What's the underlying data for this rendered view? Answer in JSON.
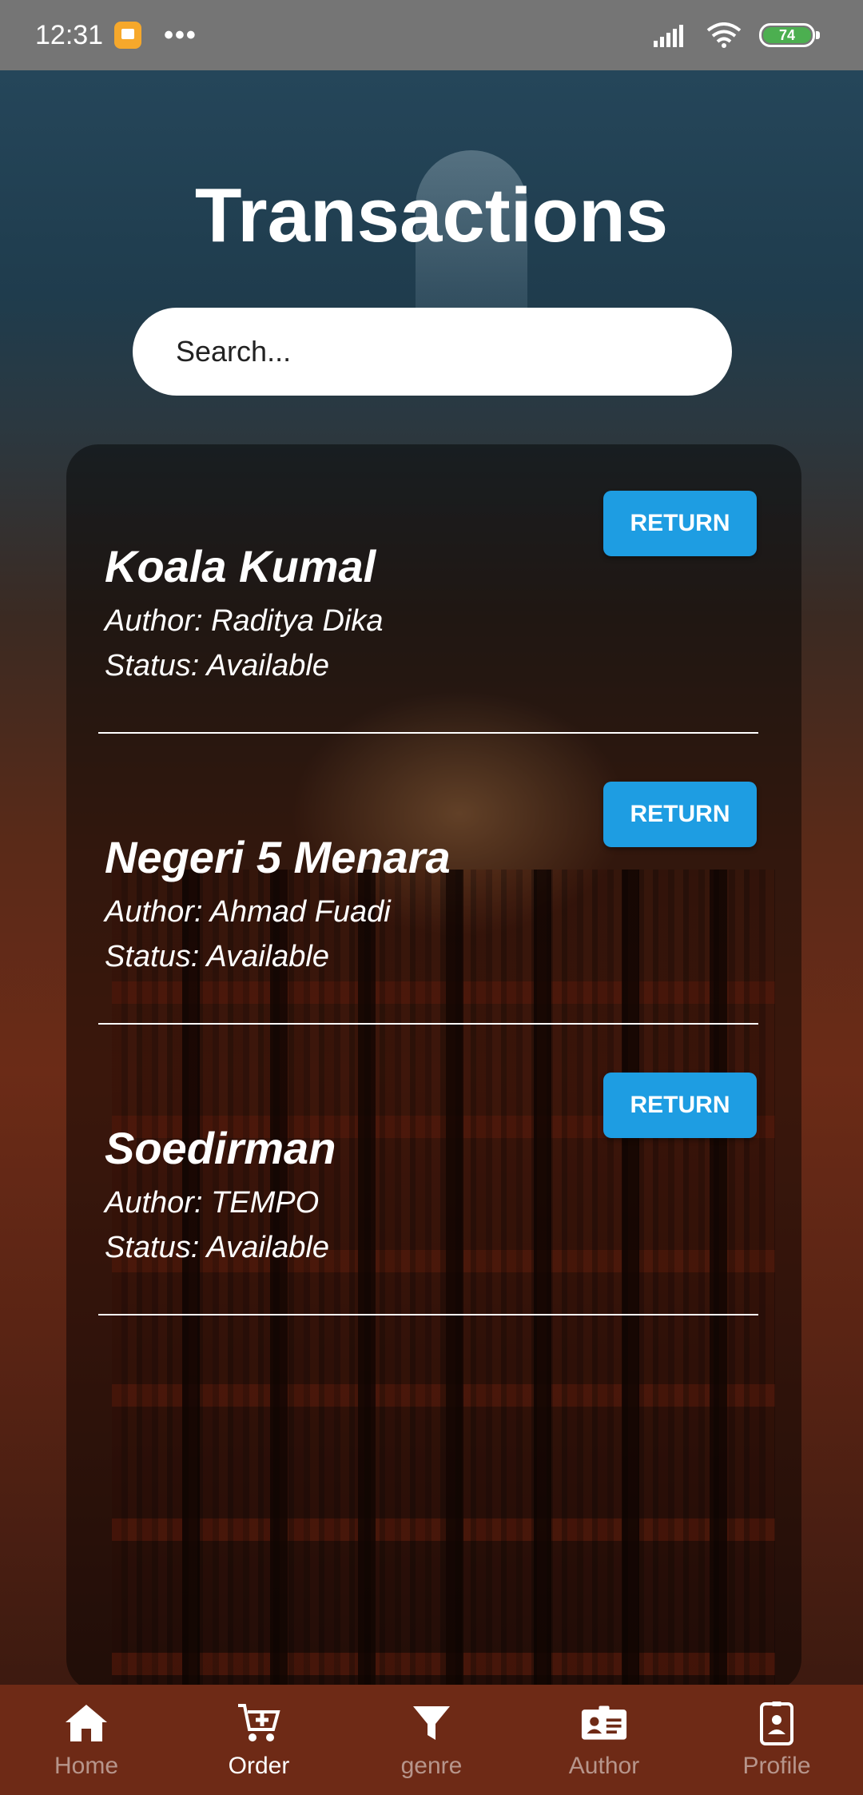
{
  "status_bar": {
    "time": "12:31",
    "more": "•••",
    "battery_level": "74"
  },
  "header": {
    "title": "Transactions"
  },
  "search": {
    "placeholder": "Search..."
  },
  "transactions": [
    {
      "title": "Koala Kumal",
      "author": "Author: Raditya Dika",
      "status": "Status: Available",
      "action": "RETURN"
    },
    {
      "title": "Negeri 5 Menara",
      "author": "Author: Ahmad Fuadi",
      "status": "Status: Available",
      "action": "RETURN"
    },
    {
      "title": "Soedirman",
      "author": "Author: TEMPO",
      "status": "Status: Available",
      "action": "RETURN"
    }
  ],
  "bottom_nav": {
    "items": [
      {
        "label": "Home",
        "icon": "home-icon",
        "active": false
      },
      {
        "label": "Order",
        "icon": "cart-add-icon",
        "active": true
      },
      {
        "label": "genre",
        "icon": "filter-icon",
        "active": false
      },
      {
        "label": "Author",
        "icon": "contact-card-icon",
        "active": false
      },
      {
        "label": "Profile",
        "icon": "id-badge-icon",
        "active": false
      }
    ]
  },
  "colors": {
    "accent": "#1e9de2",
    "nav_background": "#6e2a16",
    "status_bar": "#757575"
  }
}
